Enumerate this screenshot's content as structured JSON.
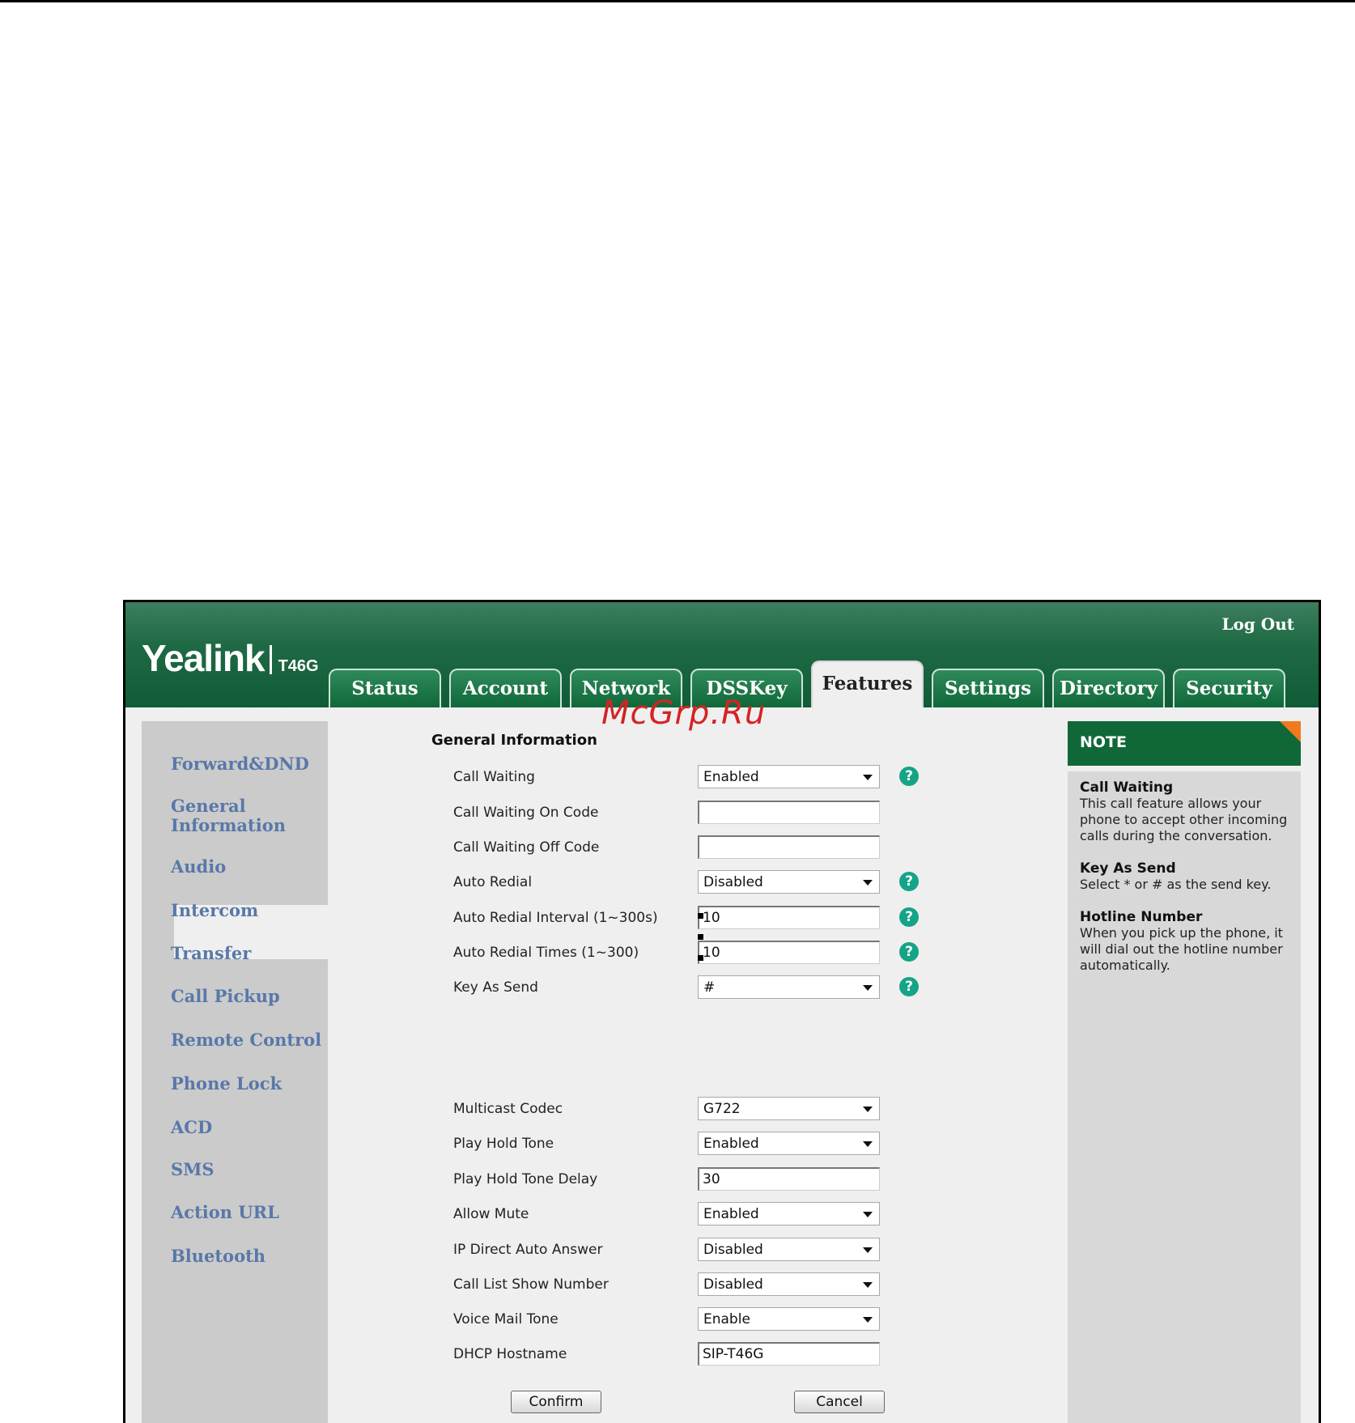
{
  "header": {
    "logout": "Log Out",
    "brand": "Yealink",
    "model": "T46G",
    "tabs": [
      "Status",
      "Account",
      "Network",
      "DSSKey",
      "Features",
      "Settings",
      "Directory",
      "Security"
    ],
    "active_tab": "Features"
  },
  "sidebar": {
    "items": [
      "Forward&DND",
      "General Information",
      "Audio",
      "Intercom",
      "Transfer",
      "Call Pickup",
      "Remote Control",
      "Phone Lock",
      "ACD",
      "SMS",
      "Action URL",
      "Bluetooth"
    ],
    "active": "General Information"
  },
  "form": {
    "title": "General Information",
    "rows": [
      {
        "label": "Call Waiting",
        "type": "select",
        "value": "Enabled",
        "help": true
      },
      {
        "label": "Call Waiting On Code",
        "type": "input",
        "value": "",
        "help": false
      },
      {
        "label": "Call Waiting Off Code",
        "type": "input",
        "value": "",
        "help": false
      },
      {
        "label": "Auto Redial",
        "type": "select",
        "value": "Disabled",
        "help": true
      },
      {
        "label": "Auto Redial Interval (1~300s)",
        "type": "input",
        "value": "10",
        "help": true
      },
      {
        "label": "Auto Redial Times (1~300)",
        "type": "input",
        "value": "10",
        "help": true
      },
      {
        "label": "Key As Send",
        "type": "select",
        "value": "#",
        "help": true
      },
      {
        "label": "Multicast Codec",
        "type": "select",
        "value": "G722",
        "help": false
      },
      {
        "label": "Play Hold Tone",
        "type": "select",
        "value": "Enabled",
        "help": false
      },
      {
        "label": "Play Hold Tone Delay",
        "type": "input",
        "value": "30",
        "help": false
      },
      {
        "label": "Allow Mute",
        "type": "select",
        "value": "Enabled",
        "help": false
      },
      {
        "label": "IP Direct Auto Answer",
        "type": "select",
        "value": "Disabled",
        "help": false
      },
      {
        "label": "Call List Show Number",
        "type": "select",
        "value": "Disabled",
        "help": false
      },
      {
        "label": "Voice Mail Tone",
        "type": "select",
        "value": "Enable",
        "help": false
      },
      {
        "label": "DHCP Hostname",
        "type": "input",
        "value": "SIP-T46G",
        "help": false
      }
    ],
    "help_glyph": "?",
    "confirm": "Confirm",
    "cancel": "Cancel"
  },
  "note": {
    "title": "NOTE",
    "entries": [
      {
        "heading": "Call Waiting",
        "text": "This call feature allows your phone to accept other incoming calls during the conversation."
      },
      {
        "heading": "Key As Send",
        "text": "Select * or # as the send key."
      },
      {
        "heading": "Hotline Number",
        "text": "When you pick up the phone, it will dial out the hotline number automatically."
      }
    ]
  },
  "watermark": "McGrp.Ru",
  "colors": {
    "header_green": "#106839",
    "sidebar_link": "#5878a8",
    "help_icon": "#15a487",
    "note_corner": "#f07a1e",
    "watermark": "#d42323"
  }
}
